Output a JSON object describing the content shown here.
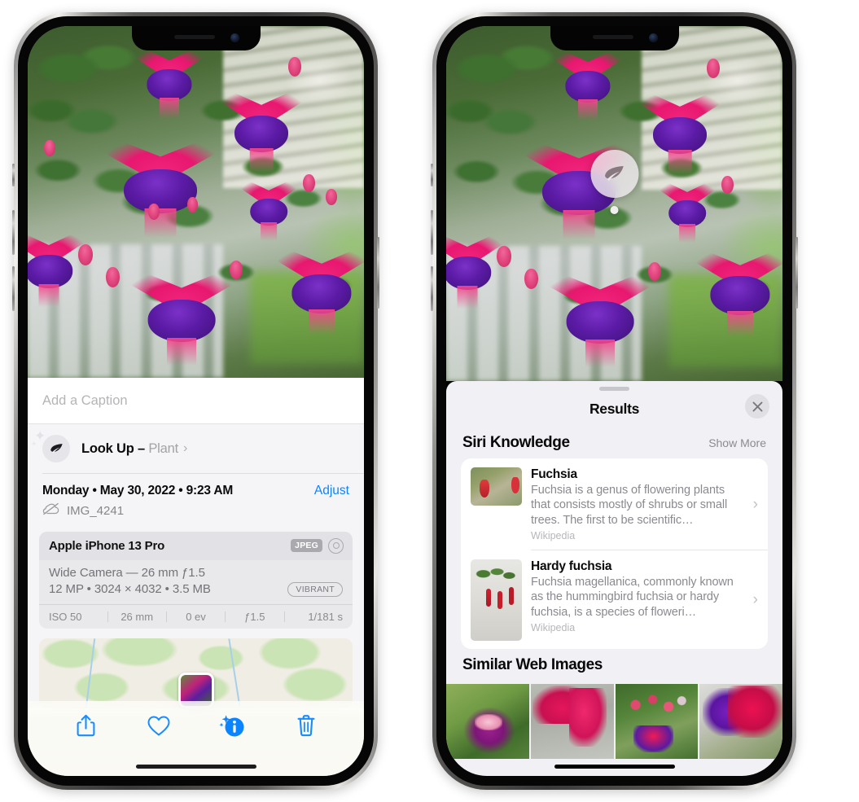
{
  "left_phone": {
    "photo": {
      "alt": "fuchsia-flowers-photo"
    },
    "caption_field": {
      "placeholder": "Add a Caption",
      "value": ""
    },
    "lookup_row": {
      "icon": "leaf-icon",
      "label": "Look Up – ",
      "subject": "Plant",
      "chevron": "›"
    },
    "metadata": {
      "date": "Monday • May 30, 2022 • 9:23 AM",
      "adjust_label": "Adjust",
      "cloud_icon": "icloud-slash-icon",
      "filename": "IMG_4241"
    },
    "camera_card": {
      "device": "Apple iPhone 13 Pro",
      "format_badge": "JPEG",
      "aperture_icon": "aperture-icon",
      "lens_line": "Wide Camera — 26 mm ƒ1.5",
      "specs_line": "12 MP • 3024 × 4032 • 3.5 MB",
      "style_badge": "VIBRANT",
      "exif": [
        "ISO 50",
        "26 mm",
        "0 ev",
        "ƒ1.5",
        "1/181 s"
      ]
    },
    "map": {
      "pin": "photo-thumbnail-pin"
    },
    "toolbar": [
      {
        "name": "share-icon",
        "label": "Share"
      },
      {
        "name": "heart-icon",
        "label": "Favorite"
      },
      {
        "name": "info-sparkle-icon",
        "label": "Info"
      },
      {
        "name": "trash-icon",
        "label": "Delete"
      }
    ]
  },
  "right_phone": {
    "visual_lookup_badge": {
      "icon": "leaf-icon"
    },
    "sheet": {
      "grabber": "sheet-grabber",
      "title": "Results",
      "close_icon": "close-icon"
    },
    "siri_knowledge": {
      "section_title": "Siri Knowledge",
      "action_label": "Show More",
      "items": [
        {
          "title": "Fuchsia",
          "description": "Fuchsia is a genus of flowering plants that consists mostly of shrubs or small trees. The first to be scientific…",
          "source": "Wikipedia",
          "thumb": "fuchsia-red-flowers-thumb",
          "chevron": "›"
        },
        {
          "title": "Hardy fuchsia",
          "description": "Fuchsia magellanica, commonly known as the hummingbird fuchsia or hardy fuchsia, is a species of floweri…",
          "source": "Wikipedia",
          "thumb": "hardy-fuchsia-specimen-thumb",
          "chevron": "›"
        }
      ]
    },
    "similar_web_images": {
      "section_title": "Similar Web Images",
      "items": [
        {
          "name": "web-image-1"
        },
        {
          "name": "web-image-2"
        },
        {
          "name": "web-image-3"
        },
        {
          "name": "web-image-4"
        }
      ]
    }
  },
  "colors": {
    "accent_blue": "#0a84ff",
    "sheet_bg": "#f1f1f5",
    "card_bg": "#ffffff",
    "secondary_text": "#8a8a90"
  }
}
